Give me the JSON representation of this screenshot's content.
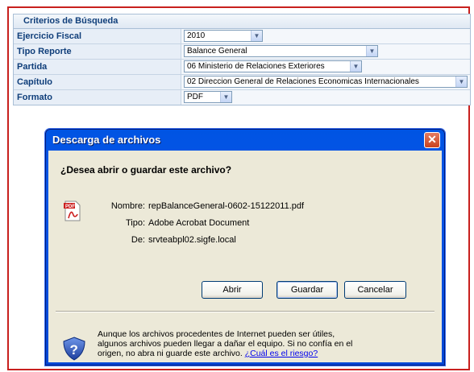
{
  "criteria": {
    "header": "Criterios de Búsqueda",
    "rows": [
      {
        "label": "Ejercicio Fiscal",
        "value": "2010"
      },
      {
        "label": "Tipo Reporte",
        "value": "Balance General"
      },
      {
        "label": "Partida",
        "value": "06 Ministerio de Relaciones Exteriores"
      },
      {
        "label": "Capítulo",
        "value": "02 Direccion General de Relaciones Economicas Internacionales"
      },
      {
        "label": "Formato",
        "value": "PDF"
      }
    ]
  },
  "dialog": {
    "title": "Descarga de archivos",
    "question": "¿Desea abrir o guardar este archivo?",
    "file_icon": "pdf-file-icon",
    "fields": [
      {
        "label": "Nombre:",
        "value": "repBalanceGeneral-0602-15122011.pdf"
      },
      {
        "label": "Tipo:",
        "value": "Adobe Acrobat Document"
      },
      {
        "label": "De:",
        "value": "srvteabpl02.sigfe.local"
      }
    ],
    "buttons": {
      "open": "Abrir",
      "save": "Guardar",
      "cancel": "Cancelar"
    },
    "warning_icon": "security-shield-icon",
    "warning_text": "Aunque los archivos procedentes de Internet pueden ser útiles, algunos archivos pueden llegar a dañar el equipo. Si no confía en el origen, no abra ni guarde este archivo.",
    "warning_link": "¿Cuál es el riesgo?",
    "close_glyph": "✕"
  },
  "colors": {
    "frame_border": "#c8201e",
    "title_bar": "#0054e3",
    "link": "#0000ee"
  }
}
